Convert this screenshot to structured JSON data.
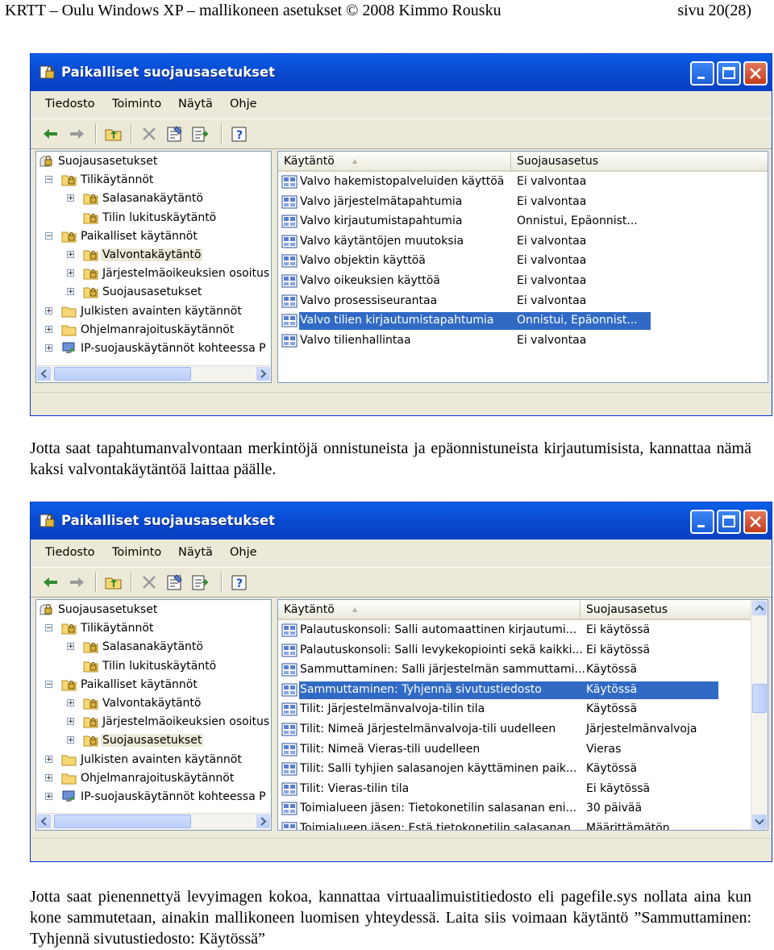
{
  "header": {
    "left": "KRTT – Oulu  Windows XP – mallikoneen asetukset   © 2008 Kimmo Rousku",
    "right": "sivu 20(28)"
  },
  "window": {
    "title": "Paikalliset suojausasetukset",
    "menu": [
      "Tiedosto",
      "Toiminto",
      "Näytä",
      "Ohje"
    ]
  },
  "tree": [
    "Suojausasetukset",
    "Tilikäytännöt",
    "Salasanakäytäntö",
    "Tilin lukituskäytäntö",
    "Paikalliset käytännöt",
    "Valvontakäytäntö",
    "Järjestelmäoikeuksien osoitus",
    "Suojausasetukset",
    "Julkisten avainten käytännöt",
    "Ohjelmanrajoituskäytännöt",
    "IP-suojauskäytännöt kohteessa P"
  ],
  "columns": {
    "policy": "Käytäntö",
    "setting": "Suojausasetus"
  },
  "list1": [
    {
      "policy": "Valvo hakemistopalveluiden käyttöä",
      "setting": "Ei valvontaa"
    },
    {
      "policy": "Valvo järjestelmätapahtumia",
      "setting": "Ei valvontaa"
    },
    {
      "policy": "Valvo kirjautumistapahtumia",
      "setting": "Onnistui, Epäonnist..."
    },
    {
      "policy": "Valvo käytäntöjen muutoksia",
      "setting": "Ei valvontaa"
    },
    {
      "policy": "Valvo objektin käyttöä",
      "setting": "Ei valvontaa"
    },
    {
      "policy": "Valvo oikeuksien käyttöä",
      "setting": "Ei valvontaa"
    },
    {
      "policy": "Valvo prosessiseurantaa",
      "setting": "Ei valvontaa"
    },
    {
      "policy": "Valvo tilien kirjautumistapahtumia",
      "setting": "Onnistui, Epäonnist..."
    },
    {
      "policy": "Valvo tilienhallintaa",
      "setting": "Ei valvontaa"
    }
  ],
  "list2": [
    {
      "policy": "Palautuskonsoli: Salli automaattinen kirjautumi...",
      "setting": "Ei käytössä"
    },
    {
      "policy": "Palautuskonsoli: Salli levykekopiointi sekä kaikki...",
      "setting": "Ei käytössä"
    },
    {
      "policy": "Sammuttaminen: Salli järjestelmän sammuttami...",
      "setting": "Käytössä"
    },
    {
      "policy": "Sammuttaminen: Tyhjennä sivutustiedosto",
      "setting": "Käytössä"
    },
    {
      "policy": "Tilit: Järjestelmänvalvoja-tilin tila",
      "setting": "Käytössä"
    },
    {
      "policy": "Tilit: Nimeä Järjestelmänvalvoja-tili uudelleen",
      "setting": "Järjestelmänvalvoja"
    },
    {
      "policy": "Tilit: Nimeä Vieras-tili uudelleen",
      "setting": "Vieras"
    },
    {
      "policy": "Tilit: Salli tyhjien salasanojen käyttäminen paik...",
      "setting": "Käytössä"
    },
    {
      "policy": "Tilit: Vieras-tilin tila",
      "setting": "Ei käytössä"
    },
    {
      "policy": "Toimialueen jäsen: Tietokonetilin salasanan eni...",
      "setting": "30 päivää"
    },
    {
      "policy": "Toimialueen jäsen: Estä tietokonetilin salasanan...",
      "setting": "Määrittämätön"
    }
  ],
  "paragraph1": "Jotta saat tapahtumanvalvontaan merkintöjä onnistuneista ja epäonnistuneista kirjautumisista, kannattaa nämä kaksi valvontakäytäntöä laittaa päälle.",
  "paragraph2": "Jotta saat pienennettyä levyimagen kokoa, kannattaa virtuaalimuistitiedosto eli pagefile.sys nollata aina kun kone sammutetaan, ainakin mallikoneen luomisen yhteydessä. Laita siis voimaan käytäntö ”Sammuttaminen: Tyhjennä sivutustiedosto: Käytössä”"
}
